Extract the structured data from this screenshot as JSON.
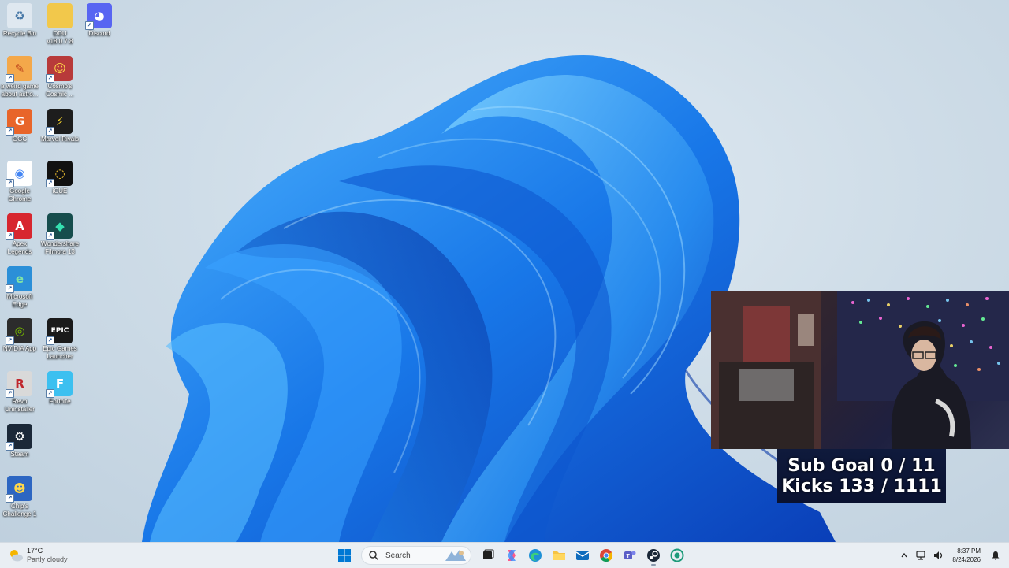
{
  "desktop_icons": [
    {
      "label": "Recycle Bin",
      "icon": "recycle-bin-icon"
    },
    {
      "label": "DDU v18.0.7.8",
      "icon": "folder-icon"
    },
    {
      "label": "Discord",
      "icon": "discord-icon"
    },
    {
      "label": "a weird game about astro...",
      "icon": "game-icon"
    },
    {
      "label": "Cosmo's Cosmic ...",
      "icon": "cosmo-game-icon"
    },
    {
      "label": "GGC",
      "icon": "ggc-icon"
    },
    {
      "label": "Marvel Rivals",
      "icon": "marvel-rivals-icon"
    },
    {
      "label": "Google Chrome",
      "icon": "chrome-icon"
    },
    {
      "label": "iCUE",
      "icon": "icue-icon"
    },
    {
      "label": "Apex Legends",
      "icon": "apex-legends-icon"
    },
    {
      "label": "Wondershare Filmora 13",
      "icon": "filmora-icon"
    },
    {
      "label": "Microsoft Edge",
      "icon": "edge-icon"
    },
    {
      "label": "NVIDIA App",
      "icon": "nvidia-icon"
    },
    {
      "label": "Epic Games Launcher",
      "icon": "epic-games-icon"
    },
    {
      "label": "Revo Uninstaller",
      "icon": "revo-icon"
    },
    {
      "label": "Fortnite",
      "icon": "fortnite-icon"
    },
    {
      "label": "Steam",
      "icon": "steam-icon"
    },
    {
      "label": "Chip's Challenge 1",
      "icon": "chips-challenge-icon"
    }
  ],
  "overlay": {
    "sub_goal": "Sub Goal 0 / 11",
    "kicks": "Kicks 133 / 1111"
  },
  "taskbar": {
    "weather_temp": "17°C",
    "weather_desc": "Partly cloudy",
    "search_placeholder": "Search",
    "pinned": [
      "start-icon",
      "task-view-icon",
      "copilot-icon",
      "edge-icon",
      "file-explorer-icon",
      "outlook-icon",
      "chrome-icon",
      "teams-icon",
      "steam-icon",
      "app-icon"
    ],
    "time": "8:37 PM",
    "date": "8/24/2026"
  },
  "colors": {
    "accent": "#0078d4",
    "bloom_blue": "#1a7ee6",
    "overlay_bg": "#0f1a3c"
  }
}
